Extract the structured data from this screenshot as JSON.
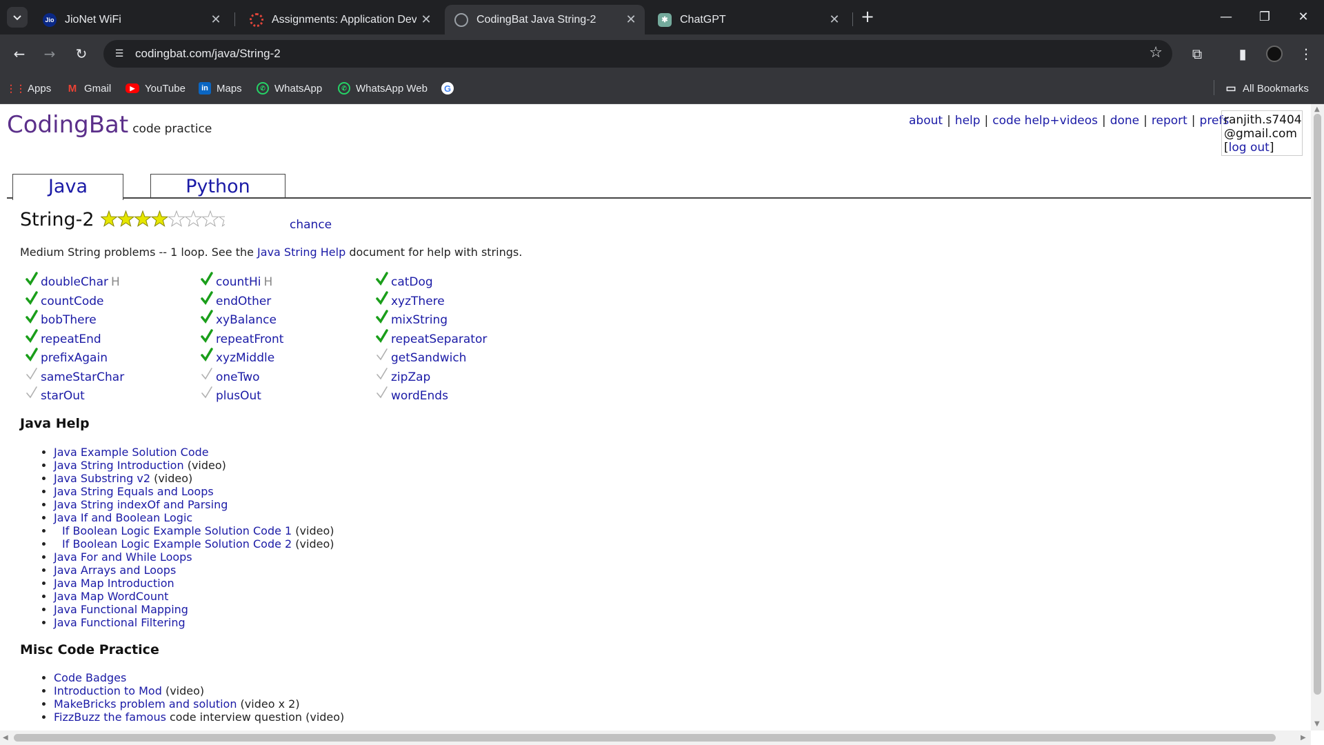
{
  "browser": {
    "tabs": [
      {
        "title": "JioNet WiFi",
        "favicon": "jio",
        "active": false
      },
      {
        "title": "Assignments: Application Devel",
        "favicon": "canvas",
        "active": false
      },
      {
        "title": "CodingBat Java String-2",
        "favicon": "globe",
        "active": true
      },
      {
        "title": "ChatGPT",
        "favicon": "chatgpt",
        "active": false
      }
    ],
    "url": "codingbat.com/java/String-2",
    "bookmarks": [
      {
        "label": "Apps",
        "icon": "apps-grid-icon"
      },
      {
        "label": "Gmail",
        "icon": "gmail-icon"
      },
      {
        "label": "YouTube",
        "icon": "youtube-icon"
      },
      {
        "label": "Maps",
        "icon": "linkedin-icon"
      },
      {
        "label": "WhatsApp",
        "icon": "whatsapp-icon"
      },
      {
        "label": "WhatsApp Web",
        "icon": "whatsapp-icon"
      },
      {
        "label": "",
        "icon": "google-icon"
      }
    ],
    "all_bookmarks": "All Bookmarks"
  },
  "site": {
    "logo": "CodingBat",
    "tagline": "code practice",
    "nav": [
      "about",
      "help",
      "code help+videos",
      "done",
      "report",
      "prefs"
    ],
    "user": {
      "line1": "ranjith.s7404",
      "line2": "@gmail.com",
      "logout": "log out"
    },
    "lang_tabs": [
      "Java",
      "Python"
    ]
  },
  "section": {
    "title": "String-2",
    "rating": {
      "filled": 4,
      "total": 8
    },
    "chance": "chance",
    "desc_before": "Medium String problems -- 1 loop. See the ",
    "desc_link": "Java String Help",
    "desc_after": " document for help with strings."
  },
  "problems": [
    [
      {
        "name": "doubleChar",
        "hint": "H",
        "done": true
      },
      {
        "name": "countCode",
        "hint": "",
        "done": true
      },
      {
        "name": "bobThere",
        "hint": "",
        "done": true
      },
      {
        "name": "repeatEnd",
        "hint": "",
        "done": true
      },
      {
        "name": "prefixAgain",
        "hint": "",
        "done": true
      },
      {
        "name": "sameStarChar",
        "hint": "",
        "done": false
      },
      {
        "name": "starOut",
        "hint": "",
        "done": false
      }
    ],
    [
      {
        "name": "countHi",
        "hint": "H",
        "done": true
      },
      {
        "name": "endOther",
        "hint": "",
        "done": true
      },
      {
        "name": "xyBalance",
        "hint": "",
        "done": true
      },
      {
        "name": "repeatFront",
        "hint": "",
        "done": true
      },
      {
        "name": "xyzMiddle",
        "hint": "",
        "done": true
      },
      {
        "name": "oneTwo",
        "hint": "",
        "done": false
      },
      {
        "name": "plusOut",
        "hint": "",
        "done": false
      }
    ],
    [
      {
        "name": "catDog",
        "hint": "",
        "done": true
      },
      {
        "name": "xyzThere",
        "hint": "",
        "done": true
      },
      {
        "name": "mixString",
        "hint": "",
        "done": true
      },
      {
        "name": "repeatSeparator",
        "hint": "",
        "done": true
      },
      {
        "name": "getSandwich",
        "hint": "",
        "done": false
      },
      {
        "name": "zipZap",
        "hint": "",
        "done": false
      },
      {
        "name": "wordEnds",
        "hint": "",
        "done": false
      }
    ]
  ],
  "java_help": {
    "title": "Java Help",
    "items": [
      {
        "link": "Java Example Solution Code",
        "suffix": ""
      },
      {
        "link": "Java String Introduction",
        "suffix": " (video)"
      },
      {
        "link": "Java Substring v2",
        "suffix": " (video)"
      },
      {
        "link": "Java String Equals and Loops",
        "suffix": ""
      },
      {
        "link": "Java String indexOf and Parsing",
        "suffix": ""
      },
      {
        "link": "Java If and Boolean Logic",
        "suffix": ""
      },
      {
        "link": "If Boolean Logic Example Solution Code 1",
        "suffix": " (video)",
        "indent": true
      },
      {
        "link": "If Boolean Logic Example Solution Code 2",
        "suffix": " (video)",
        "indent": true
      },
      {
        "link": "Java For and While Loops",
        "suffix": ""
      },
      {
        "link": "Java Arrays and Loops",
        "suffix": ""
      },
      {
        "link": "Java Map Introduction",
        "suffix": ""
      },
      {
        "link": "Java Map WordCount",
        "suffix": ""
      },
      {
        "link": "Java Functional Mapping",
        "suffix": ""
      },
      {
        "link": "Java Functional Filtering",
        "suffix": ""
      }
    ]
  },
  "misc": {
    "title": "Misc Code Practice",
    "items": [
      {
        "link": "Code Badges",
        "suffix": ""
      },
      {
        "link": "Introduction to Mod",
        "suffix": " (video)"
      },
      {
        "link": "MakeBricks problem and solution",
        "suffix": " (video x 2)"
      },
      {
        "link": "FizzBuzz the famous",
        "suffix": " code interview question (video)"
      }
    ]
  },
  "colors": {
    "check_done": "#1a9e1a",
    "check_todo": "#b0b0b0",
    "star_fill": "#e6e600",
    "link": "#1a1aa6"
  }
}
